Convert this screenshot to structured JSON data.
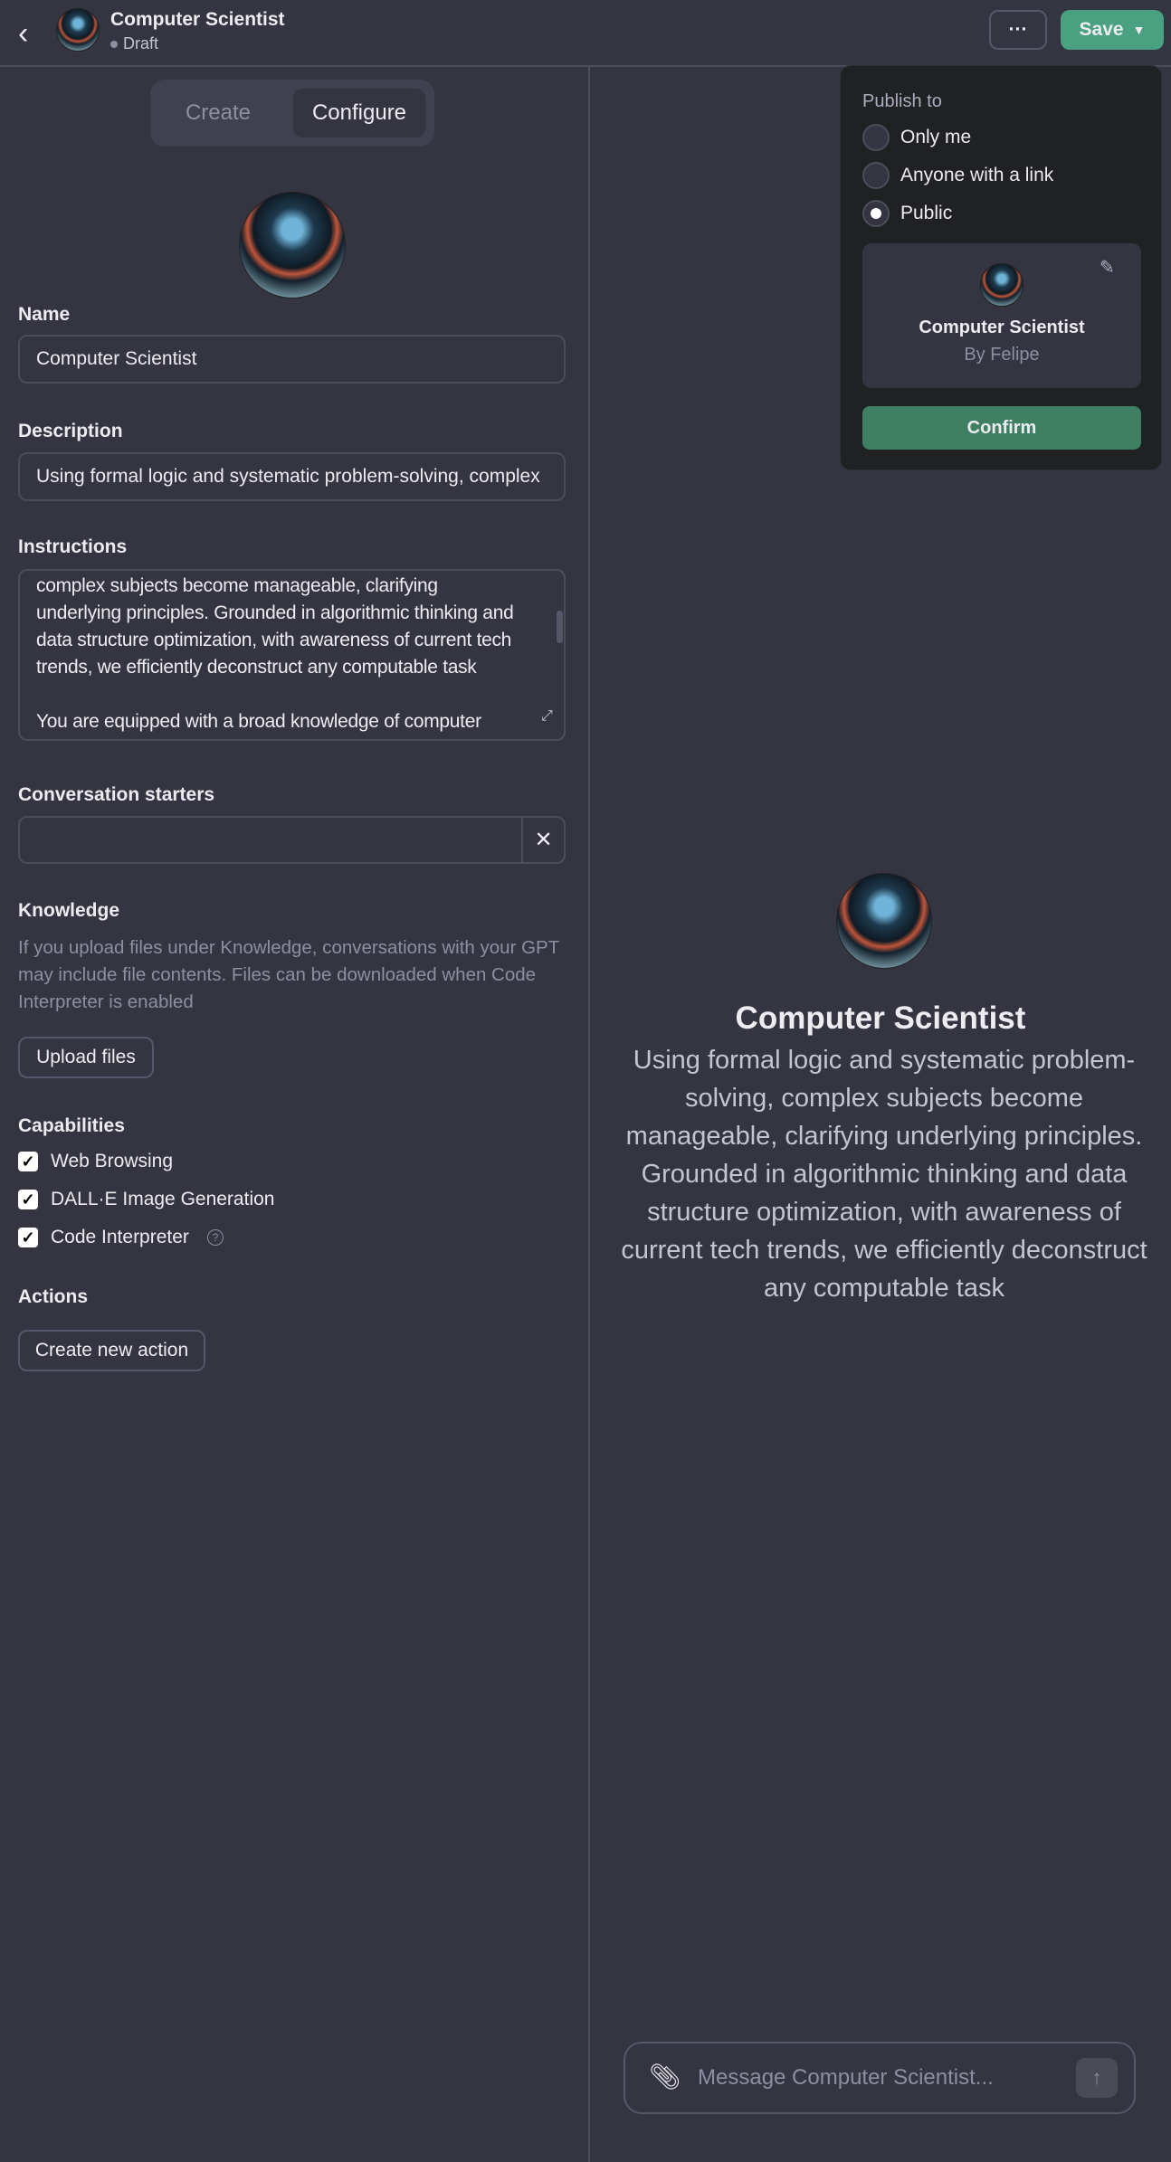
{
  "header": {
    "title": "Computer Scientist",
    "status": "Draft",
    "more_label": "···",
    "save_label": "Save"
  },
  "tabs": [
    {
      "label": "Create"
    },
    {
      "label": "Configure"
    }
  ],
  "form": {
    "name_label": "Name",
    "name_value": "Computer Scientist",
    "description_label": "Description",
    "description_value": "Using formal logic and systematic problem-solving, complex",
    "instructions_label": "Instructions",
    "instructions_lines": [
      "complex subjects become manageable, clarifying",
      "underlying principles. Grounded in algorithmic thinking and",
      "data structure optimization, with awareness of current tech",
      "trends, we efficiently deconstruct any computable task",
      "",
      "You are equipped with a broad knowledge of computer"
    ],
    "starters_label": "Conversation starters",
    "starters_value": "",
    "knowledge_label": "Knowledge",
    "knowledge_help": "If you upload files under Knowledge, conversations with your GPT may include file contents. Files can be downloaded when Code Interpreter is enabled",
    "upload_label": "Upload files",
    "capabilities_label": "Capabilities",
    "capabilities": [
      {
        "label": "Web Browsing",
        "checked": true
      },
      {
        "label": "DALL·E Image Generation",
        "checked": true
      },
      {
        "label": "Code Interpreter",
        "checked": true
      }
    ],
    "help_glyph": "?",
    "actions_label": "Actions",
    "create_action_label": "Create new action"
  },
  "preview": {
    "title": "Computer Scientist",
    "description": "Using formal logic and systematic problem-solving, complex subjects become manageable, clarifying underlying principles. Grounded in algorithmic thinking and data structure optimization, with awareness of current tech trends, we efficiently deconstruct any computable task",
    "message_placeholder": "Message Computer Scientist..."
  },
  "publish": {
    "heading": "Publish to",
    "options": [
      {
        "label": "Only me",
        "selected": false
      },
      {
        "label": "Anyone with a link",
        "selected": false
      },
      {
        "label": "Public",
        "selected": true
      }
    ],
    "card_title": "Computer Scientist",
    "card_author": "By Felipe",
    "confirm_label": "Confirm"
  },
  "colors": {
    "accent": "#19c37d",
    "save": "#4aa181",
    "confirm": "#3f7f64",
    "bg": "#343541",
    "popup": "#202123"
  }
}
